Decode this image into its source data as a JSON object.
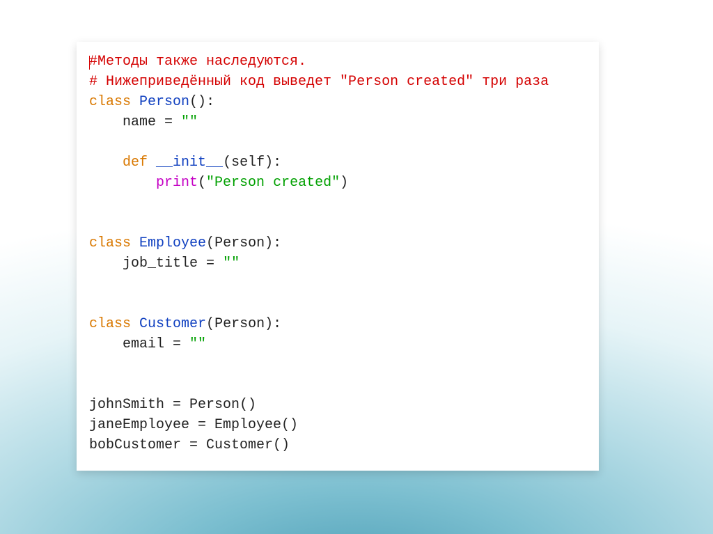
{
  "code": {
    "comment1_hash": "#",
    "comment1_text": "Методы также наследуются.",
    "comment2": "# Нижеприведённый код выведет \"Person created\" три раза",
    "kw_class": "class",
    "kw_def": "def",
    "name_Person": "Person",
    "name_Employee": "Employee",
    "name_Customer": "Customer",
    "attr_name": "name",
    "attr_job": "job_title",
    "attr_email": "email",
    "eq": " = ",
    "empty_str": "\"\"",
    "init_name": "__init__",
    "self_param": "(self):",
    "print_fn": "print",
    "print_arg": "\"Person created\"",
    "paren_open": "(",
    "paren_close": ")",
    "colon": ":",
    "paren_pair": "()",
    "var_john": "johnSmith = Person()",
    "var_jane": "janeEmployee = Employee()",
    "var_bob": "bobCustomer = Customer()"
  }
}
